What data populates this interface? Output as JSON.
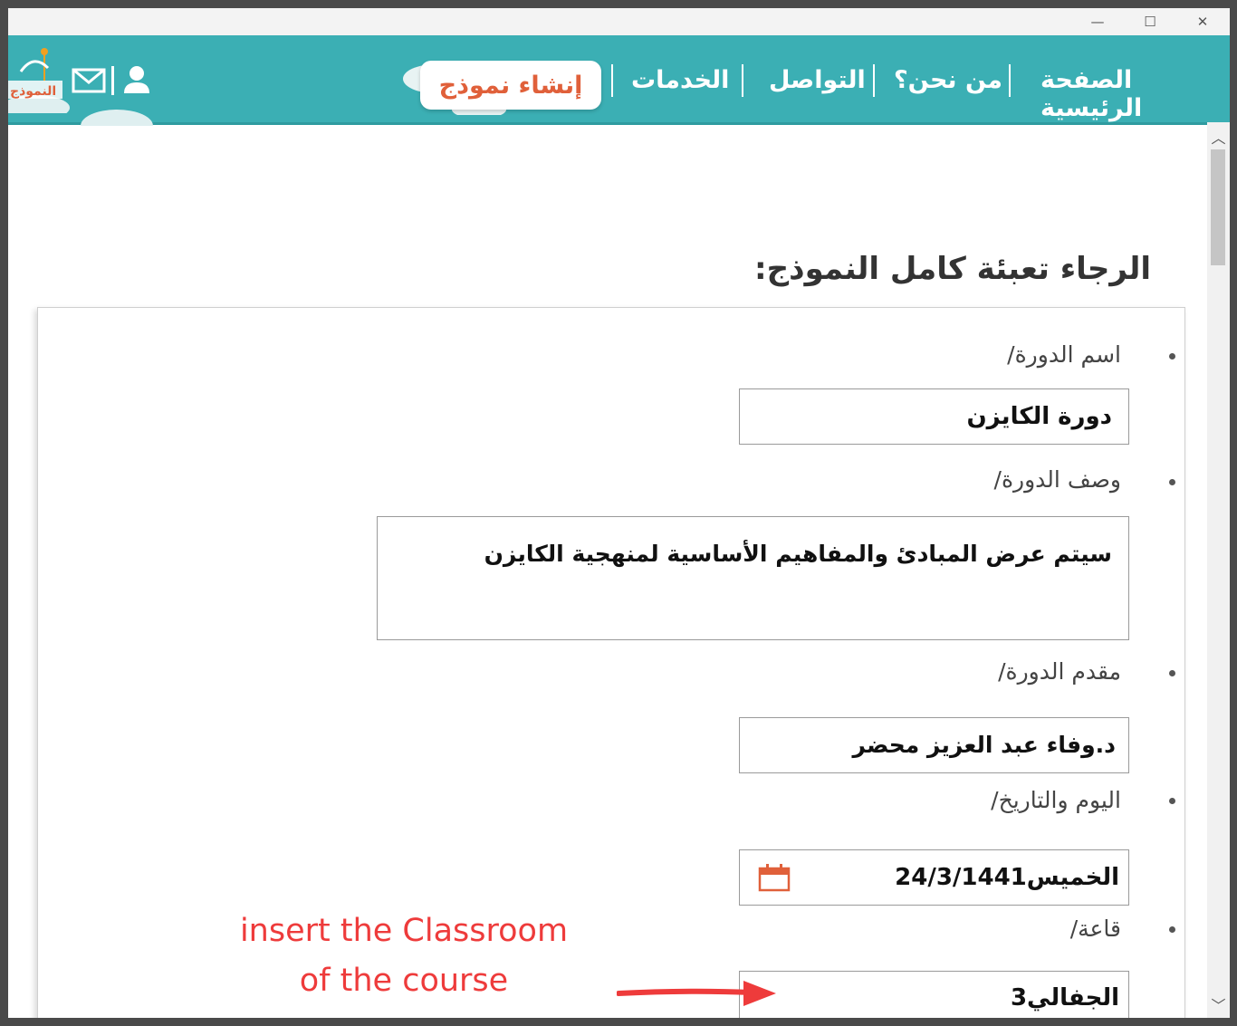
{
  "window": {
    "minimize_glyph": "—",
    "maximize_glyph": "☐",
    "close_glyph": "✕"
  },
  "nav": {
    "home": "الصفحة الرئيسية",
    "about": "من نحن؟",
    "contact": "التواصل",
    "services": "الخدمات",
    "create_form": "إنشاء نموذج",
    "logo_text": "النموذج",
    "user_icon": "user-icon",
    "mail_icon": "mail-icon"
  },
  "form": {
    "heading": "الرجاء تعبئة كامل النموذج:",
    "course_name": {
      "label": "اسم الدورة/",
      "value": "دورة الكايزن"
    },
    "course_description": {
      "label": "وصف الدورة/",
      "value": "سيتم عرض المبادئ والمفاهيم الأساسية لمنهجية الكايزن"
    },
    "course_presenter": {
      "label": "مقدم الدورة/",
      "value": "د.وفاء عبد العزيز محضر"
    },
    "day_date": {
      "label": "اليوم والتاريخ/",
      "value": "الخميس24/3/1441"
    },
    "classroom": {
      "label": "قاعة/",
      "value": "الجفالي3"
    }
  },
  "annotation": {
    "line1": "insert the Classroom",
    "line2": "of the course"
  },
  "colors": {
    "nav_bg": "#3bafb4",
    "accent": "#e0603a",
    "annotation": "#ee3b3b"
  }
}
